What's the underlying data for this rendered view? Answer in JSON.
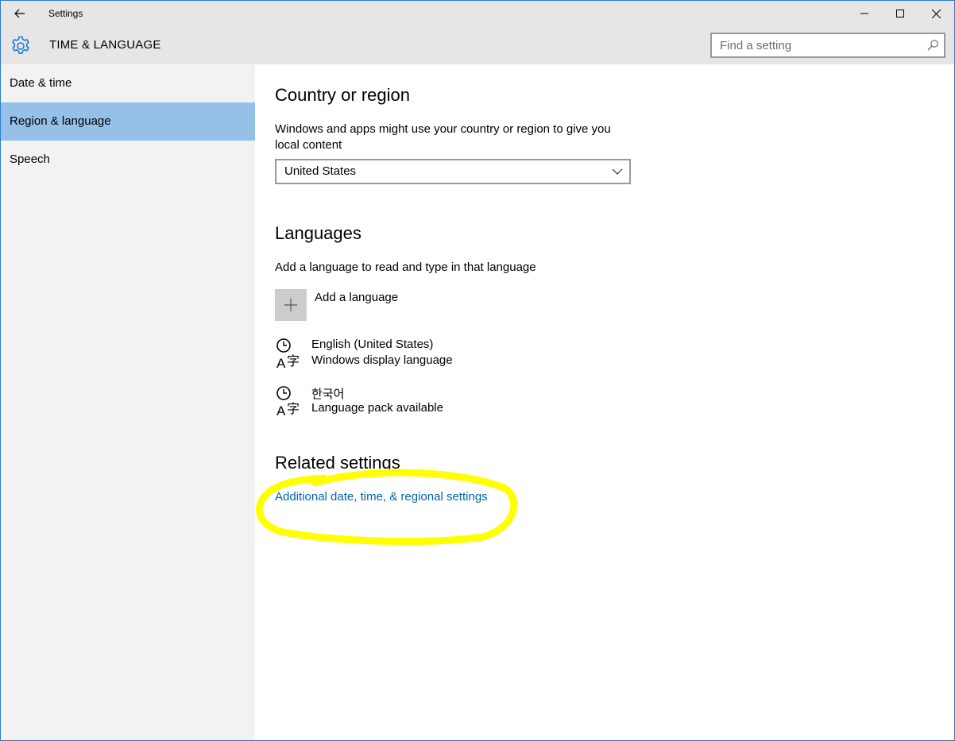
{
  "window": {
    "title": "Settings"
  },
  "header": {
    "title": "TIME & LANGUAGE",
    "search_placeholder": "Find a setting"
  },
  "sidebar": {
    "items": [
      {
        "label": "Date & time",
        "selected": false
      },
      {
        "label": "Region & language",
        "selected": true
      },
      {
        "label": "Speech",
        "selected": false
      }
    ]
  },
  "main": {
    "country": {
      "heading": "Country or region",
      "description": "Windows and apps might use your country or region to give you local content",
      "selected_value": "United States"
    },
    "languages": {
      "heading": "Languages",
      "description": "Add a language to read and type in that language",
      "add_label": "Add a language",
      "items": [
        {
          "name": "English (United States)",
          "status": "Windows display language"
        },
        {
          "name": "한국어",
          "status": "Language pack available"
        }
      ]
    },
    "related": {
      "heading": "Related settings",
      "link": "Additional date, time, & regional settings"
    }
  },
  "colors": {
    "accent": "#0063b1",
    "selected_nav": "#95c0e7",
    "highlight": "#ffff00"
  }
}
